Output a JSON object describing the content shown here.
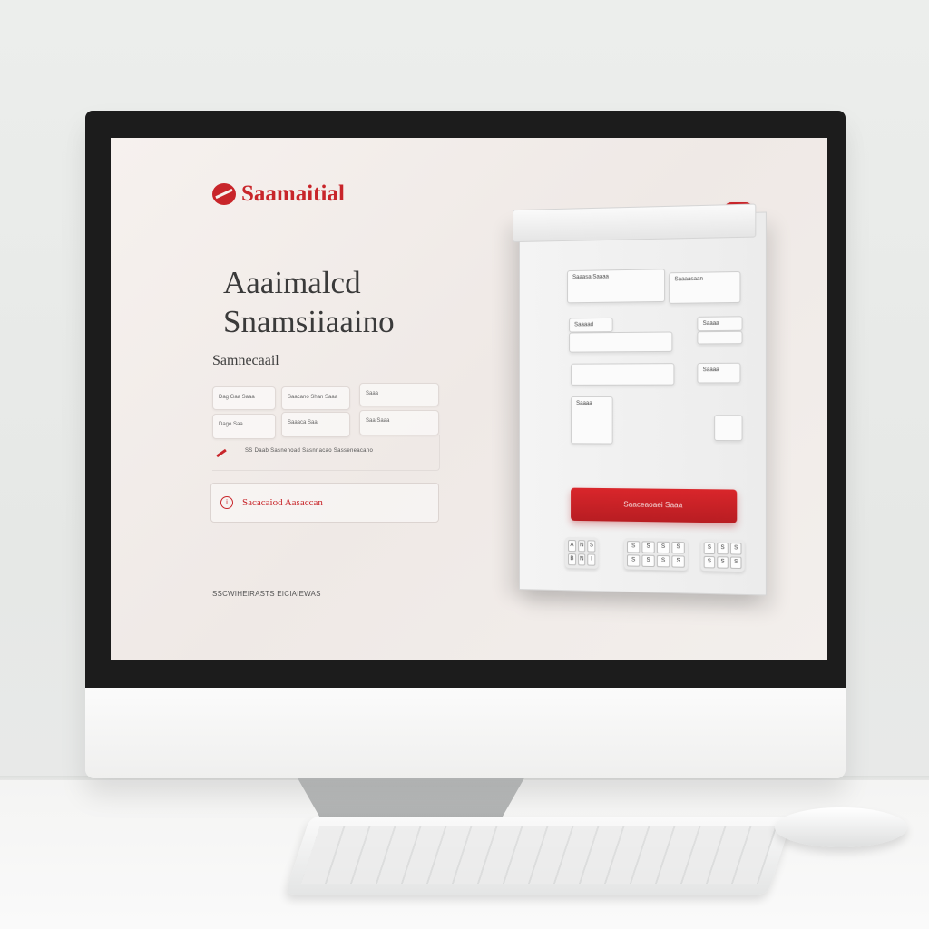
{
  "brand": {
    "name": "Saamaitial",
    "accent": "#c8252a"
  },
  "hero": {
    "line1": "Aaaimalcd",
    "line2": "Snamsiiaaino"
  },
  "section_label": "Samnecaail",
  "fields": [
    {
      "label": "Dag Gaa Saaa"
    },
    {
      "label": "Saacano Shan Saaa"
    },
    {
      "label": "Saaa"
    },
    {
      "label": "Dago Saa"
    },
    {
      "label": "Saaaca Saa"
    },
    {
      "label": "Saa Saaa"
    }
  ],
  "row_text": "SS Daab Sasnenoad Sasnnacao  Sasseneacano",
  "cta_label": "Sacacaiod Aasaccan",
  "footer_text": "SSCWIHEIRASTS EICIAIEWAS",
  "panel": {
    "fields": [
      "Saaasa Saaaa",
      "Saaaasaan",
      "Saaaad",
      "",
      "Saaaa",
      "",
      "Saaaa",
      "Saaaa"
    ],
    "submit_label": "Saaceaoaei Saaa",
    "keys_a": [
      "A",
      "N",
      "S",
      "B",
      "N",
      "I"
    ],
    "keys_b": [
      "S",
      "S",
      "S",
      "S",
      "S",
      "S",
      "S",
      "S"
    ],
    "keys_c": [
      "S",
      "S",
      "S",
      "S",
      "S",
      "S"
    ]
  }
}
